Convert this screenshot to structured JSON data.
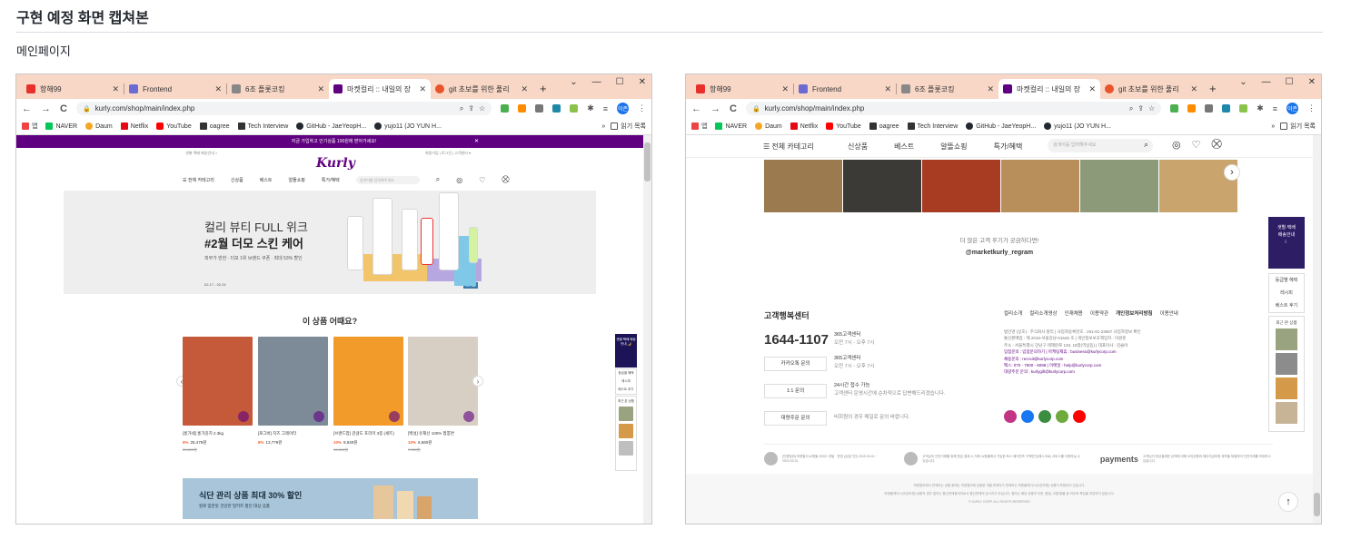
{
  "doc": {
    "title": "구현 예정 화면 캡쳐본",
    "subtitle": "메인페이지"
  },
  "browser": {
    "tabs": [
      {
        "label": "항해99",
        "favicon_color": "#e8312b"
      },
      {
        "label": "Frontend",
        "favicon_color": "#6b6bd1"
      },
      {
        "label": "6조 플롯코킹",
        "favicon_color": "#888888"
      },
      {
        "label": "마켓컬리 :: 내일의 장",
        "favicon_color": "#5f0080"
      },
      {
        "label": "git 초보를 위한 풀리",
        "favicon_color": "#e8542b"
      }
    ],
    "new_tab": "+",
    "win_min": "—",
    "win_max": "☐",
    "win_close": "✕",
    "win_menu": "⌄",
    "nav_back": "←",
    "nav_forward": "→",
    "nav_reload": "C",
    "url": "kurly.com/shop/main/index.php",
    "lock": "🔒",
    "avatar": "이존",
    "bookmarks": [
      {
        "label": "앱",
        "color": "#555555"
      },
      {
        "label": "NAVER",
        "color": "#03c75a"
      },
      {
        "label": "Daum",
        "color": "#f5a623"
      },
      {
        "label": "Netflix",
        "color": "#e50914"
      },
      {
        "label": "YouTube",
        "color": "#ff0000"
      },
      {
        "label": "oagree",
        "color": "#333333"
      },
      {
        "label": "Tech Interview",
        "color": "#333333"
      },
      {
        "label": "GitHub - JaeYeopH...",
        "color": "#24292f"
      },
      {
        "label": "yujo11 (JO YUN H...",
        "color": "#24292f"
      }
    ],
    "more": "»",
    "reading_list": "읽기 목록"
  },
  "left": {
    "promo_text": "지금 가입하고 인기상품 100원에 받아가세요!",
    "promo_close": "✕",
    "header_mini_left": "샛별·택배 배송안내 >",
    "header_mini_right": "회원가입 | 로그인 | 고객센터 ▾",
    "logo": "Kurly",
    "nav": [
      "☰ 전체 카테고리",
      "신상품",
      "베스트",
      "알뜰쇼핑",
      "특가/혜택"
    ],
    "search_placeholder": "검색어를 입력해주세요",
    "banner": {
      "line1": "컬리 뷰티 FULL 위크",
      "line2": "#2월 더모 스킨 케어",
      "line3": "피부가 반한 ∙ 더모 1위 브랜드 쿠폰 ∙ 최대 53% 할인",
      "dates": "02.17 - 02.24",
      "counter": "4 / 38"
    },
    "section_title": "이 상품 어때요?",
    "products": [
      {
        "name": "[홍가네] 홍가김치 2.3kg",
        "rate": "5%",
        "price": "25,479원",
        "orig": "26,800원",
        "color": "#c45a3a"
      },
      {
        "name": "[로그바] 치즈 그레이터",
        "rate": "8%",
        "price": "13,779원",
        "orig": "",
        "color": "#7d8b99"
      },
      {
        "name": "[브랜드팜] 감귤도 포리미 3종 (세트)",
        "rate": "10%",
        "price": "9,540원",
        "orig": "10,600원",
        "color": "#f29b2a"
      },
      {
        "name": "[백설] 유재선 100% 짬뽕면",
        "rate": "10%",
        "price": "6,560원",
        "orig": "7,300원",
        "color": "#d7cfc4"
      }
    ],
    "side_banner": "샛별·택배 배송안내 🌙",
    "side_links": [
      "등급별 혜택",
      "레시피",
      "베스트 후기"
    ],
    "recent_title": "최근 본 상품",
    "promo2_title": "식단 관리 상품 최대 30% 할인",
    "promo2_sub": "칼로 맞춘듯 건강한 밀키트 할인 대상 상품",
    "scroll_thumb_fraction": 0.1
  },
  "right": {
    "menu": "☰ 전체 카테고리",
    "nav": [
      "신상품",
      "베스트",
      "알뜰쇼핑",
      "특가/혜택"
    ],
    "search_placeholder": "검색어를 입력해주세요",
    "gallery_text": "더 많은 고객 후기가 궁금하다면!",
    "gallery_handle": "@marketkurly_regram",
    "gallery_next": "›",
    "side_banner_1": "샛별·택배",
    "side_banner_2": "배송안내",
    "side_links": [
      "등급별 혜택",
      "레시피",
      "베스트 후기"
    ],
    "recent_title": "최근 본 상품",
    "cs_title": "고객행복센터",
    "cs_phone": "1644-1107",
    "cs_phone_desc1": "365고객센터",
    "cs_phone_desc2": "오전 7시 - 오후 7시",
    "cs_kakao_button": "카카오톡 문의",
    "cs_kakao_desc1": "365고객센터",
    "cs_kakao_desc2": "오전 7시 - 오후 7시",
    "cs_1to1_button": "1:1 문의",
    "cs_1to1_desc1": "24시간 접수 가능",
    "cs_1to1_desc2": "고객센터 운영시간에 순차적으로 답변해드리겠습니다.",
    "cs_bulk_button": "대량주문 문의",
    "cs_bulk_desc": "비회원의 경우 메일로 문의 바랍니다.",
    "footer_links": [
      "컬리소개",
      "컬리소개영상",
      "인재채용",
      "이용약관",
      "개인정보처리방침",
      "이용안내"
    ],
    "company_lines": [
      "법인명 (상호) : 주식회사 컬리 | 사업자등록번호 : 261-81-23567 사업자정보 확인",
      "통신판매업 : 제 2018-서울강남-01646 호 | 개인정보보호책임자 : 이원준",
      "주소 : 서울특별시 강남구 테헤란로 133, 18층(역삼동) | 대표이사 : 김슬아",
      "입점문의 : 입점문의하기 | 마케팅제휴 : business@kurlycorp.com",
      "채용문의 : recruit@kurlycorp.com",
      "팩스: 070 - 7500 - 6098 | 이메일 : help@kurlycorp.com",
      "대량주문 문의 : kurlygift@kurlycorp.com"
    ],
    "sns_colors": [
      "#c13584",
      "#1877f2",
      "#3c8d40",
      "#6eaa3c",
      "#ff0000"
    ],
    "certs": [
      "[인증범위] 마켓컬리 쇼핑몰 서비스 개발 · 운영 (유효기간) 2019.04.01 ~ 2022.03.31",
      "고객님의 안전거래를 위해 현금 결제 시 저희 쇼핑몰에서 가입한 토스 페이먼츠 구매안전(에스크로) 서비스를 이용하실 수 있습니다.",
      "payments",
      "고객님이 현금결제한 금액에 대해 우리은행과 채무지급보증 계약을 체결하여 안전거래를 보장하고 있습니다."
    ],
    "copyright_1": "마켓컬리에서 판매되는 상품 중에는 마켓컬리에 입점한 개별 판매자가 판매하는 마켓플레이스(오픈마켓) 상품이 포함되어 있습니다.",
    "copyright_2": "마켓플레이스(오픈마켓) 상품의 경우 컬리는 통신판매중개자로서 통신판매의 당사자가 아닙니다. 컬리는 해당 상품의 주문, 품질, 교환/환불 등 의무와 책임을 부담하지 않습니다.",
    "copyright_3": "© KURLY CORP. ALL RIGHTS RESERVED",
    "top_button": "↑",
    "scroll_thumb_fraction": 0.06
  }
}
